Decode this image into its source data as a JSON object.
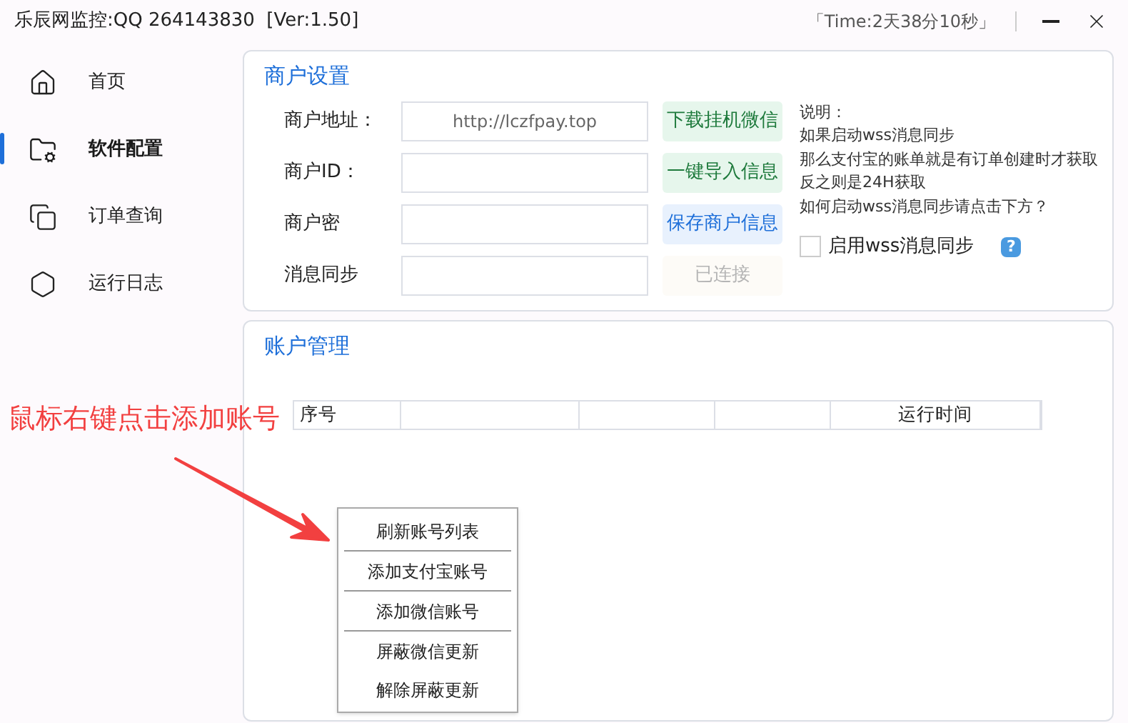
{
  "window": {
    "title": "乐辰网监控:QQ 264143830  [Ver:1.50]",
    "timer": "「Time:2天38分10秒」"
  },
  "sidebar": {
    "items": [
      {
        "label": "首页",
        "selected": false
      },
      {
        "label": "软件配置",
        "selected": true
      },
      {
        "label": "订单查询",
        "selected": false
      },
      {
        "label": "运行日志",
        "selected": false
      }
    ]
  },
  "merchant": {
    "title": "商户设置",
    "rows": [
      {
        "label": "商户地址：",
        "value": "http://lczfpay.top",
        "button": {
          "label": "下载挂机微信",
          "kind": "green"
        }
      },
      {
        "label": "商户ID：",
        "button": {
          "label": "一键导入信息",
          "kind": "green"
        }
      },
      {
        "label": "商户密",
        "button": {
          "label": "保存商户信息",
          "kind": "blue"
        }
      },
      {
        "label": "消息同步",
        "button": {
          "label": "已连接",
          "kind": "disabled"
        }
      }
    ],
    "notes": [
      "说明：",
      "如果启动wss消息同步",
      "那么支付宝的账单就是有订单创建时才获取",
      "反之则是24H获取",
      "如何启动wss消息同步请点击下方？"
    ],
    "wss": {
      "label": "启用wss消息同步",
      "checked": false,
      "help": "?"
    }
  },
  "accounts": {
    "title": "账户管理",
    "columns": [
      "序号",
      null,
      null,
      null,
      "运行时间"
    ]
  },
  "annotation": "鼠标右键点击添加账号",
  "context_menu": [
    {
      "label": "刷新账号列表",
      "divider_after": true
    },
    {
      "label": "添加支付宝账号",
      "divider_after": true
    },
    {
      "label": "添加微信账号",
      "divider_after": true
    },
    {
      "label": "屏蔽微信更新",
      "divider_after": false
    },
    {
      "label": "解除屏蔽更新",
      "divider_after": false
    }
  ]
}
